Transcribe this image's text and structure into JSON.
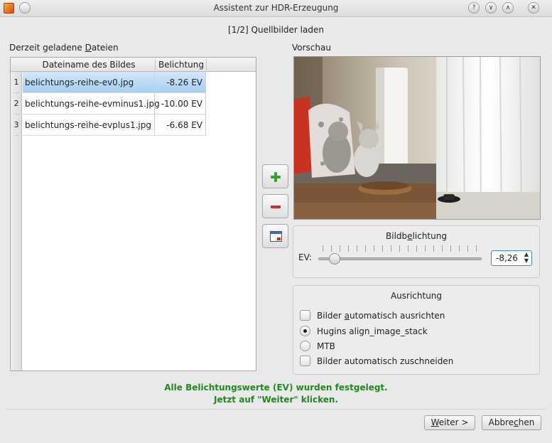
{
  "titlebar": {
    "title": "Assistent zur HDR-Erzeugung",
    "buttons": [
      "?",
      "∨",
      "∧",
      "✕"
    ]
  },
  "step": "[1/2] Quellbilder laden",
  "files_panel": {
    "label_pre": "Derzeit geladene ",
    "label_accel": "D",
    "label_post": "ateien",
    "headers": {
      "name": "Dateiname des Bildes",
      "exposure": "Belichtung"
    },
    "rows": [
      {
        "num": "1",
        "name": "belichtungs-reihe-ev0.jpg",
        "exposure": "-8.26 EV",
        "selected": true
      },
      {
        "num": "2",
        "name": "belichtungs-reihe-evminus1.jpg",
        "exposure": "-10.00 EV",
        "selected": false
      },
      {
        "num": "3",
        "name": "belichtungs-reihe-evplus1.jpg",
        "exposure": "-6.68 EV",
        "selected": false
      }
    ]
  },
  "side_buttons": {
    "add": "add-image",
    "remove": "remove-image",
    "preview": "show-image"
  },
  "preview": {
    "label": "Vorschau"
  },
  "exposure_group": {
    "title_pre": "Bildb",
    "title_accel": "e",
    "title_post": "lichtung",
    "ev_label": "EV:",
    "slider_level_percent": 10,
    "spin_value": "-8,26"
  },
  "alignment_group": {
    "title": "Ausrichtung",
    "opt1_pre": "Bilder ",
    "opt1_accel": "a",
    "opt1_post": "utomatisch ausrichten",
    "opt2": "Hugins align_image_stack",
    "opt3": "MTB",
    "opt4": "Bilder automatisch zuschneiden",
    "selected_option": "Hugins align_image_stack"
  },
  "status": {
    "line1": "Alle Belichtungswerte (EV) wurden festgelegt.",
    "line2": "Jetzt auf \"Weiter\" klicken.",
    "color": "#1f8a1c"
  },
  "footer": {
    "next_accel": "W",
    "next_post": "eiter >",
    "cancel_pre": "Abbre",
    "cancel_accel": "c",
    "cancel_post": "hen"
  }
}
